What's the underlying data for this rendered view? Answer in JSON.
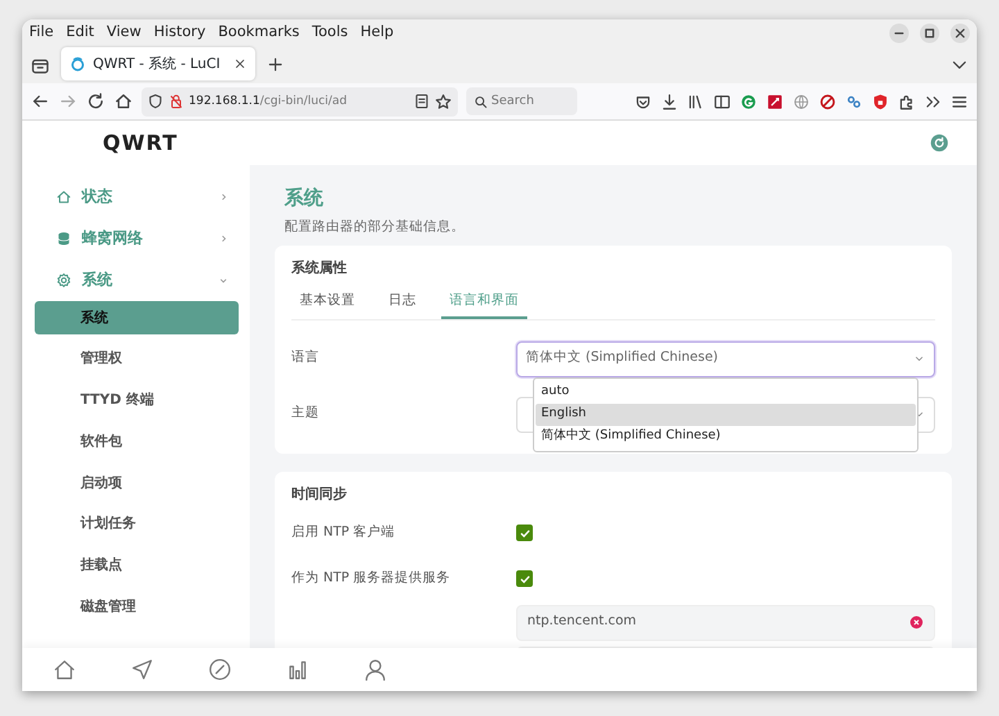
{
  "menu_bar": [
    "File",
    "Edit",
    "View",
    "History",
    "Bookmarks",
    "Tools",
    "Help"
  ],
  "browser_tab": {
    "title": "QWRT - 系统 - LuCI"
  },
  "address_bar": {
    "host": "192.168.1.1",
    "path": "/cgi-bin/luci/ad"
  },
  "search": {
    "placeholder": "Search"
  },
  "brand": "QWRT",
  "sidebar": {
    "items": [
      {
        "label": "状态",
        "expanded": false
      },
      {
        "label": "蜂窝网络",
        "expanded": false
      },
      {
        "label": "系统",
        "expanded": true,
        "children": [
          {
            "label": "系统",
            "selected": true
          },
          {
            "label": "管理权",
            "selected": false
          },
          {
            "label": "TTYD 终端",
            "selected": false
          },
          {
            "label": "软件包",
            "selected": false
          },
          {
            "label": "启动项",
            "selected": false
          },
          {
            "label": "计划任务",
            "selected": false
          },
          {
            "label": "挂载点",
            "selected": false
          },
          {
            "label": "磁盘管理",
            "selected": false
          }
        ]
      }
    ]
  },
  "page": {
    "title": "系统",
    "description": "配置路由器的部分基础信息。"
  },
  "properties": {
    "title": "系统属性",
    "tabs": [
      {
        "label": "基本设置",
        "selected": false
      },
      {
        "label": "日志",
        "selected": false
      },
      {
        "label": "语言和界面",
        "selected": true
      }
    ],
    "rows": [
      {
        "label": "语言",
        "kind": "select",
        "value": "简体中文 (Simplified Chinese)",
        "expanded": true,
        "options": [
          {
            "label": "auto",
            "highlighted": false
          },
          {
            "label": "English",
            "highlighted": true
          },
          {
            "label": "简体中文 (Simplified Chinese)",
            "highlighted": false
          }
        ]
      },
      {
        "label": "主题",
        "kind": "select",
        "expanded": false
      }
    ]
  },
  "time_sync": {
    "title": "时间同步",
    "rows": [
      {
        "label": "启用 NTP 客户端",
        "kind": "checkbox",
        "checked": true
      },
      {
        "label": "作为 NTP 服务器提供服务",
        "kind": "checkbox",
        "checked": true
      },
      {
        "kind": "server",
        "value": "ntp.tencent.com"
      },
      {
        "kind": "server"
      }
    ]
  }
}
